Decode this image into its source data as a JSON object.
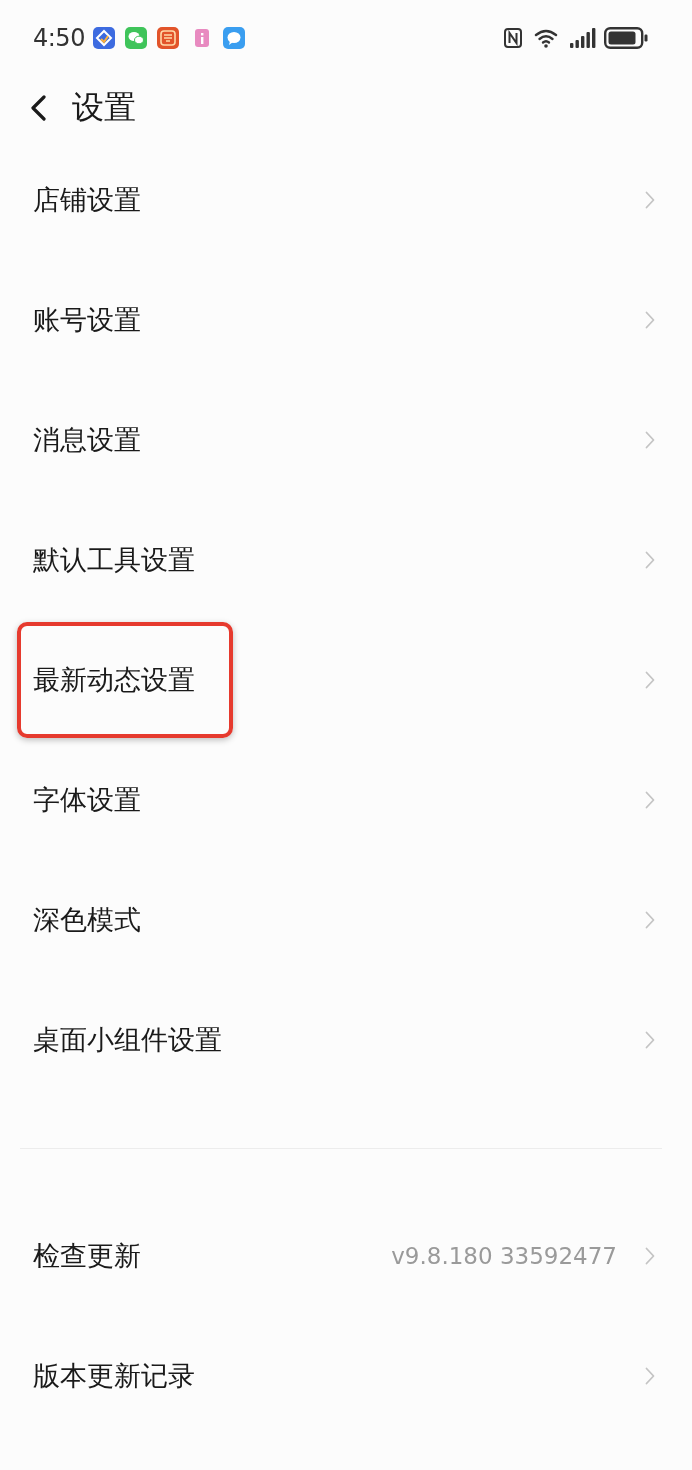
{
  "status_bar": {
    "time": "4:50"
  },
  "header": {
    "title": "设置"
  },
  "sections": [
    {
      "items": [
        {
          "label": "店铺设置",
          "highlighted": false
        },
        {
          "label": "账号设置",
          "highlighted": false
        },
        {
          "label": "消息设置",
          "highlighted": false
        },
        {
          "label": "默认工具设置",
          "highlighted": false
        },
        {
          "label": "最新动态设置",
          "highlighted": true
        },
        {
          "label": "字体设置",
          "highlighted": false
        },
        {
          "label": "深色模式",
          "highlighted": false
        },
        {
          "label": "桌面小组件设置",
          "highlighted": false
        }
      ]
    },
    {
      "items": [
        {
          "label": "检查更新",
          "value": "v9.8.180 33592477",
          "highlighted": false
        },
        {
          "label": "版本更新记录",
          "highlighted": false
        }
      ]
    }
  ]
}
